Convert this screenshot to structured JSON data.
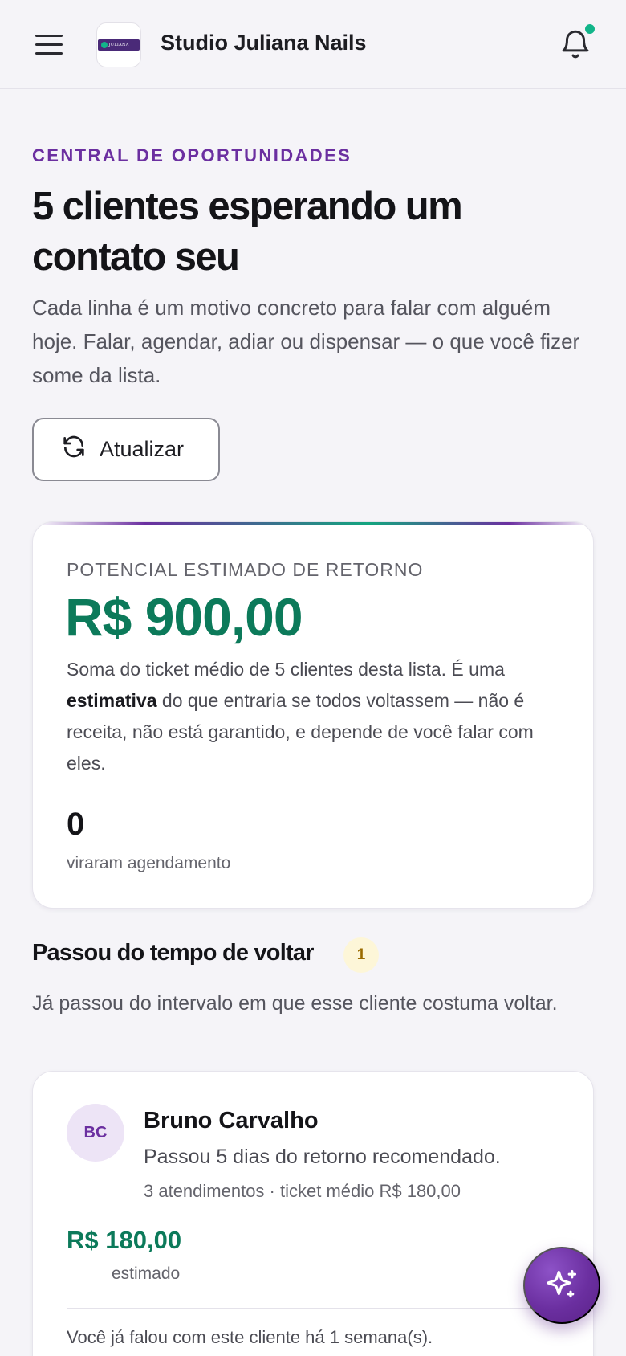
{
  "header": {
    "brand_name": "Studio Juliana Nails",
    "logo_text": "JULIANA",
    "menu_icon": "hamburger-menu-icon",
    "notification_icon": "bell-icon",
    "notification_dot_color": "#12b58a"
  },
  "hero": {
    "eyebrow": "CENTRAL DE OPORTUNIDADES",
    "title": "5 clientes esperando um contato seu",
    "subtitle": "Cada linha é um motivo concreto para falar com alguém hoje. Falar, agendar, adiar ou dispensar — o que você fizer some da lista.",
    "refresh_label": "Atualizar"
  },
  "potential": {
    "label": "POTENCIAL ESTIMADO DE RETORNO",
    "value": "R$ 900,00",
    "text_before": "Soma do ticket médio de 5 clientes desta lista. É uma ",
    "text_bold": "estimativa",
    "text_after": " do que entraria se todos voltassem — não é receita, não está garantido, e depende de você falar com eles.",
    "count": "0",
    "count_label": "viraram agendamento"
  },
  "section": {
    "title": "Passou do tempo de voltar",
    "badge": "1",
    "subtitle": "Já passou do intervalo em que esse cliente costuma voltar."
  },
  "clients": [
    {
      "initials": "BC",
      "name": "Bruno Carvalho",
      "reason": "Passou 5 dias do retorno recomendado.",
      "meta": "3 atendimentos · ticket médio R$ 180,00",
      "value": "R$ 180,00",
      "value_label": "estimado",
      "note": "Você já falou com este cliente há 1 semana(s)."
    }
  ],
  "fab": {
    "icon": "sparkles-icon"
  },
  "colors": {
    "accent_purple": "#6b2fa0",
    "money_green": "#0c7a5a",
    "background": "#f5f4f8"
  }
}
